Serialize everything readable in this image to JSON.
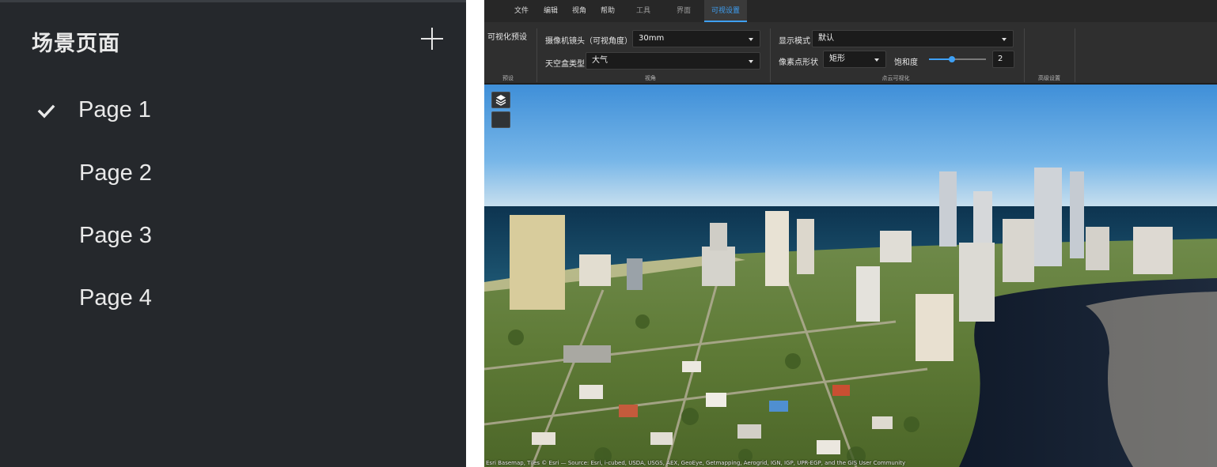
{
  "sidebar": {
    "title": "场景页面",
    "add_icon": "plus-icon",
    "check_icon": "check-icon",
    "pages": [
      {
        "label": "Page 1",
        "active": true
      },
      {
        "label": "Page 2",
        "active": false
      },
      {
        "label": "Page 3",
        "active": false
      },
      {
        "label": "Page 4",
        "active": false
      }
    ]
  },
  "menubar": {
    "tabs": [
      "文件",
      "编辑",
      "视角",
      "帮助",
      "工具",
      "界面",
      "可视设置"
    ],
    "active_tab": "可视设置",
    "accent_color": "#3ea0f5"
  },
  "ribbon": {
    "preset": {
      "label": "可视化预设",
      "group": "预设"
    },
    "view": {
      "camera_label": "摄像机镜头（可视角度）",
      "camera_value": "30mm",
      "skybox_label": "天空盒类型",
      "skybox_value": "大气",
      "group": "视角"
    },
    "pointcloud": {
      "display_mode_label": "显示模式",
      "display_mode_value": "默认",
      "pixel_shape_label": "像素点形状",
      "pixel_shape_value": "矩形",
      "saturation_label": "饱和度",
      "saturation_value": "2",
      "saturation_fraction": 0.4,
      "group": "点云可视化"
    },
    "advanced": {
      "group": "高级设置"
    }
  },
  "viewport": {
    "layers_icon": "layers-icon",
    "attribution": "Esri Basemap, Tiles © Esri — Source: Esri, i-cubed, USDA, USGS, AEX, GeoEye, Getmapping, Aerogrid, IGN, IGP, UPR-EGP, and the GIS User Community"
  }
}
